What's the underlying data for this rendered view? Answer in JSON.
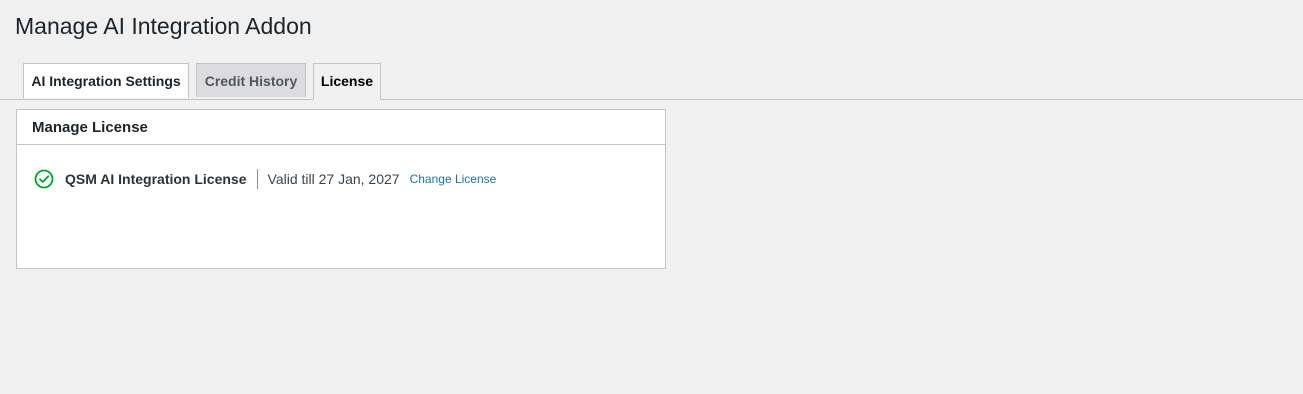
{
  "page": {
    "title": "Manage AI Integration Addon"
  },
  "tabs": [
    {
      "label": "AI Integration Settings"
    },
    {
      "label": "Credit History"
    },
    {
      "label": "License"
    }
  ],
  "panel": {
    "header": "Manage License",
    "license": {
      "status_icon": "check-circle-icon",
      "status_color": "#00a32a",
      "name": "QSM AI Integration License",
      "validity": "Valid till 27 Jan, 2027",
      "change_link": "Change License"
    }
  }
}
